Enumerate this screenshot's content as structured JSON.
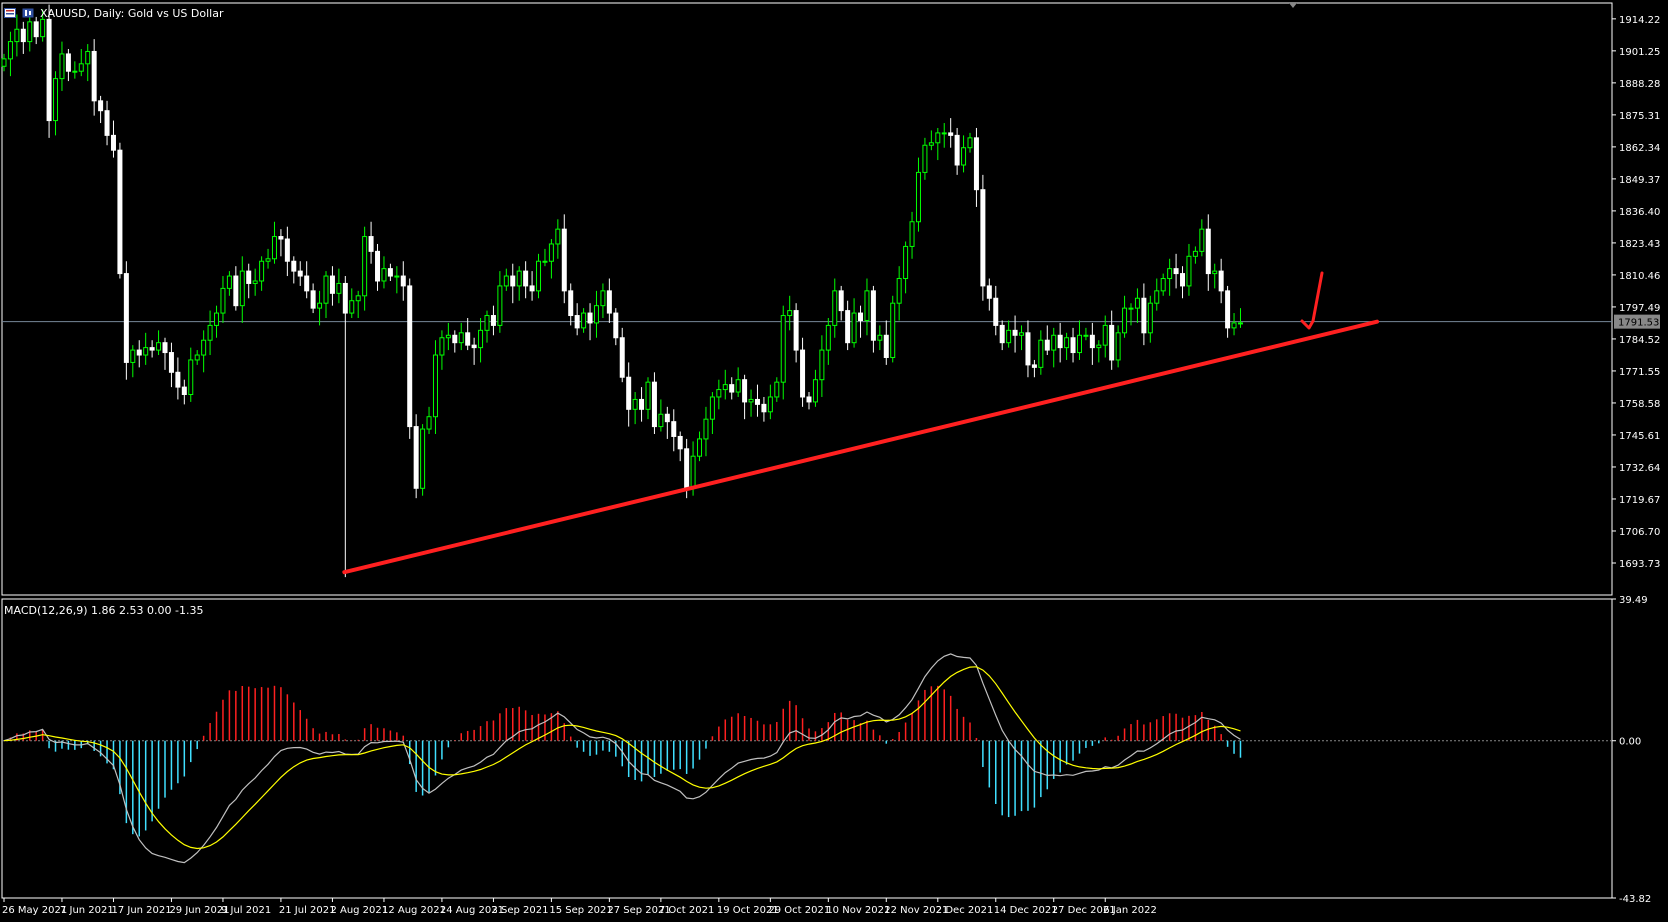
{
  "header": {
    "symbol": "XAUUSD, Daily:",
    "description": "Gold vs US Dollar"
  },
  "colors": {
    "background": "#000000",
    "bull_candle": "#00ff00",
    "bear_candle": "#ffffff",
    "trendline": "#ff2020",
    "macd_line": "#c0c0c0",
    "signal_line": "#ffff00",
    "hist_positive": "#ff2020",
    "hist_negative": "#40e0ff",
    "price_line": "#778899"
  },
  "current_price_label": "1791.53",
  "chart_data": [
    {
      "type": "candlestick",
      "title": "XAUUSD, Daily: Gold vs US Dollar",
      "ylim": [
        1680.76,
        1920.64
      ],
      "y_ticks": [
        "1914.22",
        "1901.25",
        "1888.28",
        "1875.31",
        "1862.34",
        "1849.37",
        "1836.40",
        "1823.43",
        "1810.46",
        "1797.49",
        "1784.52",
        "1771.55",
        "1758.58",
        "1745.61",
        "1732.64",
        "1719.67",
        "1706.70",
        "1693.73"
      ],
      "x_ticks": [
        "26 May 2021",
        "7 Jun 2021",
        "17 Jun 2021",
        "29 Jun 2021",
        "9 Jul 2021",
        "21 Jul 2021",
        "2 Aug 2021",
        "12 Aug 2021",
        "24 Aug 2021",
        "3 Sep 2021",
        "15 Sep 2021",
        "27 Sep 2021",
        "7 Oct 2021",
        "19 Oct 2021",
        "29 Oct 2021",
        "10 Nov 2021",
        "22 Nov 2021",
        "2 Dec 2021",
        "14 Dec 2021",
        "27 Dec 2021",
        "6 Jan 2022"
      ],
      "current_price": 1791.53,
      "close": [
        1898,
        1905,
        1910,
        1905,
        1913,
        1907,
        1914,
        1873,
        1890,
        1900,
        1893,
        1893,
        1896,
        1901,
        1881,
        1877,
        1867,
        1861,
        1811,
        1775,
        1780,
        1778,
        1781,
        1780,
        1783,
        1779,
        1771,
        1765,
        1762,
        1776,
        1778,
        1784,
        1790,
        1795,
        1805,
        1810,
        1798,
        1812,
        1807,
        1808,
        1816,
        1817,
        1826,
        1825,
        1816,
        1812,
        1810,
        1804,
        1797,
        1799,
        1810,
        1803,
        1807,
        1795,
        1800,
        1802,
        1826,
        1820,
        1808,
        1813,
        1810,
        1810,
        1806,
        1749,
        1724,
        1748,
        1753,
        1778,
        1785,
        1786,
        1783,
        1787,
        1782,
        1781,
        1788,
        1794,
        1790,
        1806,
        1810,
        1806,
        1812,
        1806,
        1804,
        1816,
        1816,
        1823,
        1829,
        1804,
        1794,
        1789,
        1795,
        1791,
        1798,
        1804,
        1795,
        1785,
        1769,
        1756,
        1760,
        1756,
        1767,
        1749,
        1754,
        1751,
        1745,
        1740,
        1724,
        1737,
        1744,
        1752,
        1761,
        1764,
        1766,
        1763,
        1768,
        1759,
        1760,
        1758,
        1755,
        1761,
        1767,
        1794,
        1796,
        1780,
        1761,
        1759,
        1768,
        1780,
        1790,
        1804,
        1796,
        1783,
        1795,
        1792,
        1804,
        1784,
        1786,
        1777,
        1799,
        1809,
        1822,
        1832,
        1852,
        1863,
        1864,
        1868,
        1868,
        1867,
        1855,
        1862,
        1866,
        1845,
        1806,
        1801,
        1790,
        1783,
        1788,
        1786,
        1787,
        1774,
        1773,
        1784,
        1780,
        1786,
        1781,
        1785,
        1779,
        1786,
        1786,
        1781,
        1782,
        1790,
        1776,
        1787,
        1797,
        1797,
        1801,
        1787,
        1799,
        1804,
        1809,
        1813,
        1811,
        1806,
        1818,
        1820,
        1829,
        1811,
        1812,
        1804,
        1789,
        1791,
        1791
      ],
      "macd": {
        "params": "MACD(12,26,9) 1.86 2.53 0.00 -1.35",
        "main": 1.86,
        "signal": 2.53,
        "ylim": [
          -43.82,
          39.49
        ],
        "ticks": [
          "39.49",
          "0.00",
          "-43.82"
        ]
      },
      "annotations": [
        "ascending trendline from 4 Aug 2021 low",
        "projected bounce check mark"
      ]
    }
  ]
}
